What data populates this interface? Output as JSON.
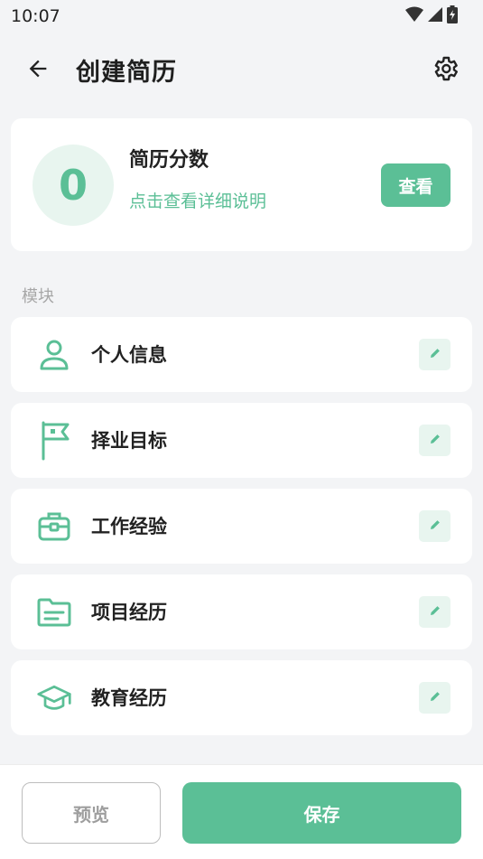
{
  "status_bar": {
    "time": "10:07",
    "icons": [
      "wifi-icon",
      "signal-icon",
      "battery-charging-icon"
    ]
  },
  "header": {
    "title": "创建简历",
    "back_icon": "arrow-left-icon",
    "settings_icon": "gear-icon"
  },
  "score_card": {
    "score": "0",
    "title": "简历分数",
    "subtitle": "点击查看详细说明",
    "view_button": "查看"
  },
  "section_label": "模块",
  "modules": [
    {
      "label": "个人信息",
      "icon": "person-icon"
    },
    {
      "label": "择业目标",
      "icon": "flag-icon"
    },
    {
      "label": "工作经验",
      "icon": "briefcase-icon"
    },
    {
      "label": "项目经历",
      "icon": "folder-icon"
    },
    {
      "label": "教育经历",
      "icon": "graduation-cap-icon"
    }
  ],
  "bottom": {
    "preview_button": "预览",
    "save_button": "保存"
  },
  "colors": {
    "accent": "#5bbf96",
    "accent_light": "#e8f5ef",
    "background": "#f3f4f6"
  }
}
